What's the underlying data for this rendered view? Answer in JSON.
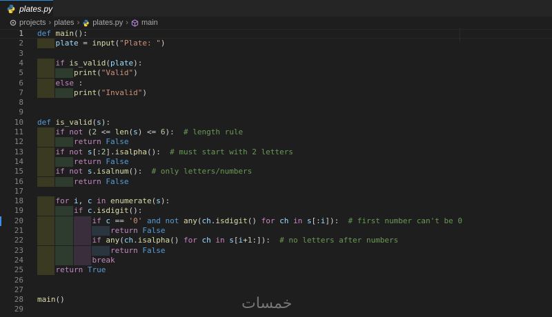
{
  "tab": {
    "label": "plates.py",
    "icon": "python-file-icon"
  },
  "breadcrumb": [
    {
      "label": "projects",
      "icon": "repo-icon"
    },
    {
      "label": "plates",
      "icon": ""
    },
    {
      "label": "plates.py",
      "icon": "python-file-icon"
    },
    {
      "label": "main",
      "icon": "function-symbol-icon"
    }
  ],
  "colors": {
    "keyword": "#569cd6",
    "control": "#c586c0",
    "function": "#dcdcaa",
    "variable": "#9cdcfe",
    "string": "#ce9178",
    "number": "#b5cea8",
    "comment": "#6a9955",
    "operator": "#d4d4d4",
    "builtin_const": "#569cd6"
  },
  "watermark": "خمسات",
  "lines": [
    {
      "n": "1",
      "tokens": [
        [
          "def ",
          "keyword"
        ],
        [
          "main",
          "function"
        ],
        [
          "():",
          "operator"
        ]
      ]
    },
    {
      "n": "2",
      "tokens": [
        [
          "    ",
          "ws"
        ],
        [
          "plate",
          "variable"
        ],
        [
          " = ",
          "operator"
        ],
        [
          "input",
          "function"
        ],
        [
          "(",
          "operator"
        ],
        [
          "\"Plate: \"",
          "string"
        ],
        [
          ")",
          "operator"
        ]
      ]
    },
    {
      "n": "3",
      "tokens": []
    },
    {
      "n": "4",
      "tokens": [
        [
          "    ",
          "ws"
        ],
        [
          "if ",
          "control"
        ],
        [
          "is_valid",
          "function"
        ],
        [
          "(",
          "operator"
        ],
        [
          "plate",
          "variable"
        ],
        [
          "):",
          "operator"
        ]
      ]
    },
    {
      "n": "5",
      "tokens": [
        [
          "        ",
          "ws"
        ],
        [
          "print",
          "function"
        ],
        [
          "(",
          "operator"
        ],
        [
          "\"Valid\"",
          "string"
        ],
        [
          ")",
          "operator"
        ]
      ]
    },
    {
      "n": "6",
      "tokens": [
        [
          "    ",
          "ws"
        ],
        [
          "else",
          "control"
        ],
        [
          " :",
          "operator"
        ]
      ]
    },
    {
      "n": "7",
      "tokens": [
        [
          "        ",
          "ws"
        ],
        [
          "print",
          "function"
        ],
        [
          "(",
          "operator"
        ],
        [
          "\"Invalid\"",
          "string"
        ],
        [
          ")",
          "operator"
        ]
      ]
    },
    {
      "n": "8",
      "tokens": []
    },
    {
      "n": "9",
      "tokens": []
    },
    {
      "n": "10",
      "tokens": [
        [
          "def ",
          "keyword"
        ],
        [
          "is_valid",
          "function"
        ],
        [
          "(",
          "operator"
        ],
        [
          "s",
          "variable"
        ],
        [
          "):",
          "operator"
        ]
      ]
    },
    {
      "n": "11",
      "tokens": [
        [
          "    ",
          "ws"
        ],
        [
          "if not ",
          "control"
        ],
        [
          "(",
          "operator"
        ],
        [
          "2",
          "number"
        ],
        [
          " <= ",
          "operator"
        ],
        [
          "len",
          "function"
        ],
        [
          "(",
          "operator"
        ],
        [
          "s",
          "variable"
        ],
        [
          ") <= ",
          "operator"
        ],
        [
          "6",
          "number"
        ],
        [
          "):  ",
          "operator"
        ],
        [
          "# length rule",
          "comment"
        ]
      ]
    },
    {
      "n": "12",
      "tokens": [
        [
          "        ",
          "ws"
        ],
        [
          "return ",
          "control"
        ],
        [
          "False",
          "builtin_const"
        ]
      ]
    },
    {
      "n": "13",
      "tokens": [
        [
          "    ",
          "ws"
        ],
        [
          "if not ",
          "control"
        ],
        [
          "s",
          "variable"
        ],
        [
          "[:",
          "operator"
        ],
        [
          "2",
          "number"
        ],
        [
          "].",
          "operator"
        ],
        [
          "isalpha",
          "function"
        ],
        [
          "():  ",
          "operator"
        ],
        [
          "# must start with 2 letters",
          "comment"
        ]
      ]
    },
    {
      "n": "14",
      "tokens": [
        [
          "        ",
          "ws"
        ],
        [
          "return ",
          "control"
        ],
        [
          "False",
          "builtin_const"
        ]
      ]
    },
    {
      "n": "15",
      "tokens": [
        [
          "    ",
          "ws"
        ],
        [
          "if not ",
          "control"
        ],
        [
          "s",
          "variable"
        ],
        [
          ".",
          "operator"
        ],
        [
          "isalnum",
          "function"
        ],
        [
          "():  ",
          "operator"
        ],
        [
          "# only letters/numbers",
          "comment"
        ]
      ]
    },
    {
      "n": "16",
      "tokens": [
        [
          "        ",
          "ws"
        ],
        [
          "return ",
          "control"
        ],
        [
          "False",
          "builtin_const"
        ]
      ]
    },
    {
      "n": "17",
      "tokens": []
    },
    {
      "n": "18",
      "tokens": [
        [
          "    ",
          "ws"
        ],
        [
          "for ",
          "control"
        ],
        [
          "i",
          "variable"
        ],
        [
          ", ",
          "operator"
        ],
        [
          "c",
          "variable"
        ],
        [
          " in ",
          "control"
        ],
        [
          "enumerate",
          "function"
        ],
        [
          "(",
          "operator"
        ],
        [
          "s",
          "variable"
        ],
        [
          "):",
          "operator"
        ]
      ]
    },
    {
      "n": "19",
      "tokens": [
        [
          "        ",
          "ws"
        ],
        [
          "if ",
          "control"
        ],
        [
          "c",
          "variable"
        ],
        [
          ".",
          "operator"
        ],
        [
          "isdigit",
          "function"
        ],
        [
          "():",
          "operator"
        ]
      ]
    },
    {
      "n": "20",
      "tokens": [
        [
          "            ",
          "ws"
        ],
        [
          "if ",
          "control"
        ],
        [
          "c",
          "variable"
        ],
        [
          " == ",
          "operator"
        ],
        [
          "'0'",
          "string"
        ],
        [
          " and not ",
          "keyword"
        ],
        [
          "any",
          "function"
        ],
        [
          "(",
          "operator"
        ],
        [
          "ch",
          "variable"
        ],
        [
          ".",
          "operator"
        ],
        [
          "isdigit",
          "function"
        ],
        [
          "() ",
          "operator"
        ],
        [
          "for ",
          "control"
        ],
        [
          "ch ",
          "variable"
        ],
        [
          "in ",
          "control"
        ],
        [
          "s",
          "variable"
        ],
        [
          "[:",
          "operator"
        ],
        [
          "i",
          "variable"
        ],
        [
          "]):  ",
          "operator"
        ],
        [
          "# first number can't be 0",
          "comment"
        ]
      ]
    },
    {
      "n": "21",
      "tokens": [
        [
          "                ",
          "ws"
        ],
        [
          "return ",
          "control"
        ],
        [
          "False",
          "builtin_const"
        ]
      ]
    },
    {
      "n": "22",
      "tokens": [
        [
          "            ",
          "ws"
        ],
        [
          "if ",
          "control"
        ],
        [
          "any",
          "function"
        ],
        [
          "(",
          "operator"
        ],
        [
          "ch",
          "variable"
        ],
        [
          ".",
          "operator"
        ],
        [
          "isalpha",
          "function"
        ],
        [
          "() ",
          "operator"
        ],
        [
          "for ",
          "control"
        ],
        [
          "ch ",
          "variable"
        ],
        [
          "in ",
          "control"
        ],
        [
          "s",
          "variable"
        ],
        [
          "[",
          "operator"
        ],
        [
          "i",
          "variable"
        ],
        [
          "+",
          "operator"
        ],
        [
          "1",
          "number"
        ],
        [
          ":]):  ",
          "operator"
        ],
        [
          "# no letters after numbers",
          "comment"
        ]
      ]
    },
    {
      "n": "23",
      "tokens": [
        [
          "                ",
          "ws"
        ],
        [
          "return ",
          "control"
        ],
        [
          "False",
          "builtin_const"
        ]
      ]
    },
    {
      "n": "24",
      "tokens": [
        [
          "            ",
          "ws"
        ],
        [
          "break",
          "control"
        ]
      ]
    },
    {
      "n": "25",
      "tokens": [
        [
          "    ",
          "ws"
        ],
        [
          "return ",
          "control"
        ],
        [
          "True",
          "builtin_const"
        ]
      ]
    },
    {
      "n": "26",
      "tokens": []
    },
    {
      "n": "27",
      "tokens": []
    },
    {
      "n": "28",
      "tokens": [
        [
          "main",
          "function"
        ],
        [
          "()",
          "operator"
        ]
      ]
    },
    {
      "n": "29",
      "tokens": []
    }
  ]
}
